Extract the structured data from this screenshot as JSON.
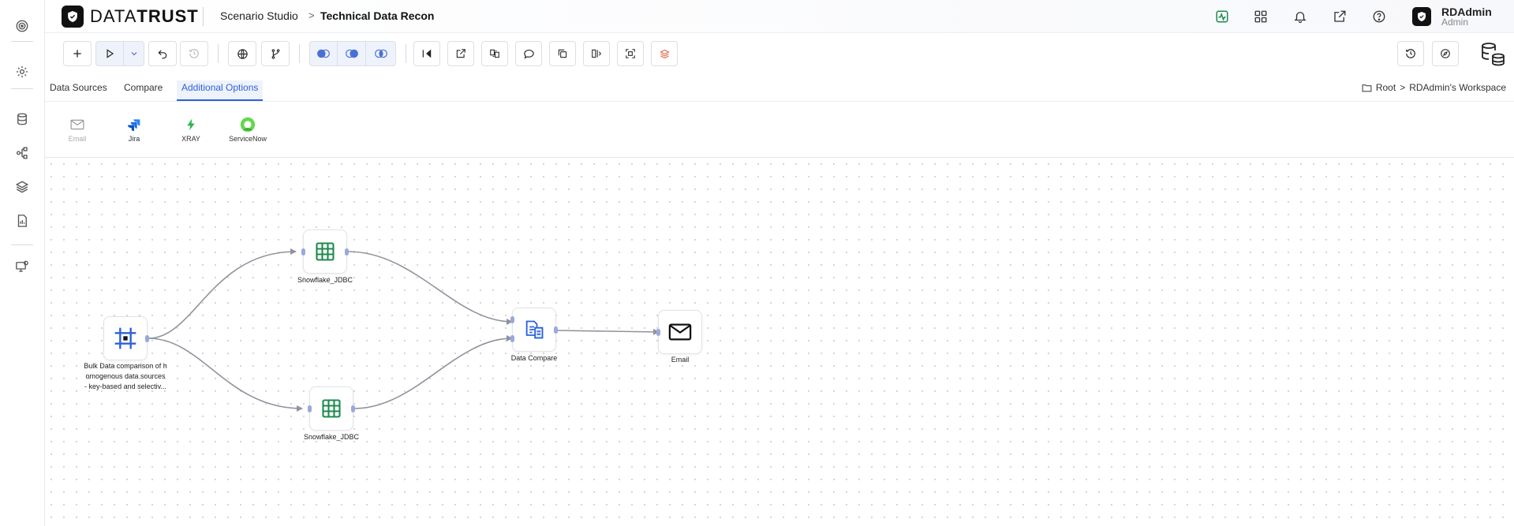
{
  "header": {
    "brand_a": "DATA",
    "brand_b": "TRUST",
    "breadcrumb": [
      "Scenario Studio",
      "Technical Data Recon"
    ],
    "user": {
      "name": "RDAdmin",
      "role": "Admin"
    },
    "icons": [
      "activity-icon",
      "apps-grid-icon",
      "bell-icon",
      "external-link-icon",
      "help-icon"
    ]
  },
  "rail": {
    "icons": [
      "target-icon",
      "gear-icon",
      "database-icon",
      "workflow-icon",
      "layers-icon",
      "report-icon",
      "monitor-settings-icon"
    ]
  },
  "toolbar": {
    "groups": [
      [
        "add-icon",
        "play-icon",
        "chevron-down-icon",
        "undo-icon",
        "history-icon"
      ],
      [
        "globe-icon",
        "branch-icon"
      ],
      [
        "join-left-icon",
        "join-inner-icon",
        "join-right-icon"
      ],
      [
        "sidebar-collapse-icon",
        "export-icon",
        "compare-files-icon",
        "comment-icon",
        "copy-icon",
        "split-view-icon",
        "fit-screen-icon",
        "stack-icon"
      ]
    ],
    "right": [
      "restore-icon",
      "compass-icon",
      "database-sync-icon"
    ]
  },
  "tabs": [
    {
      "label": "Data Sources",
      "active": false
    },
    {
      "label": "Compare",
      "active": false
    },
    {
      "label": "Additional Options",
      "active": true
    }
  ],
  "path": {
    "root": "Root",
    "workspace": "RDAdmin's Workspace"
  },
  "options": [
    {
      "label": "Email",
      "icon": "mail-icon",
      "disabled": true
    },
    {
      "label": "Jira",
      "icon": "jira-icon",
      "disabled": false
    },
    {
      "label": "XRAY",
      "icon": "xray-icon",
      "disabled": false
    },
    {
      "label": "ServiceNow",
      "icon": "servicenow-icon",
      "disabled": false
    }
  ],
  "nodes": {
    "source": [
      "Bulk Data comparison of h",
      "omogenous data sources",
      "- key-based and selectiv..."
    ],
    "snowflake_top": "Snowflake_JDBC",
    "snowflake_bottom": "Snowflake_JDBC",
    "compare": "Data Compare",
    "email": "Email"
  },
  "colors": {
    "accent": "#2e62d9",
    "green": "#1d8a4e",
    "edge": "#8f949c"
  }
}
